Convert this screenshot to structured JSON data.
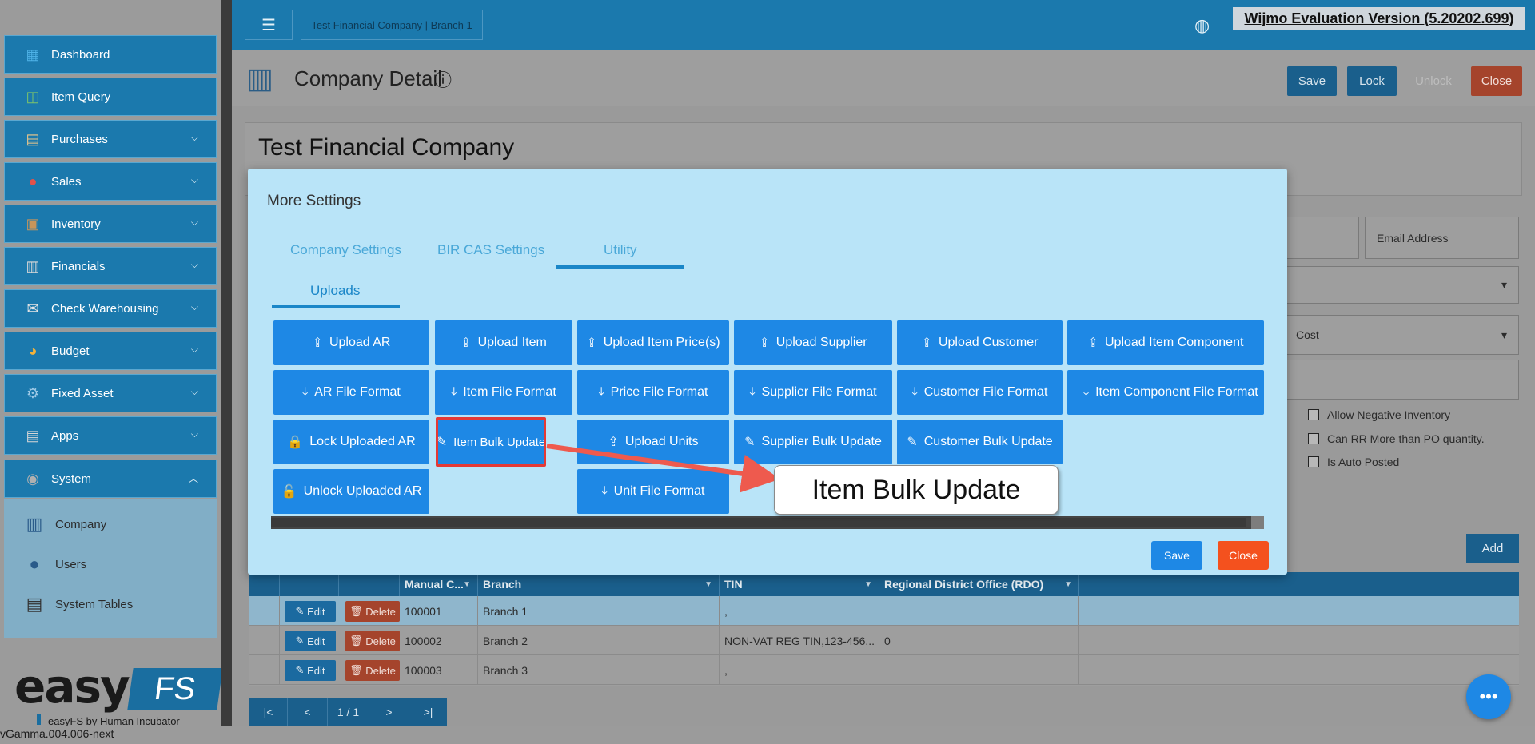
{
  "sidebar": {
    "items": [
      {
        "label": "Dashboard",
        "icon": "dashboard-icon",
        "glyph": "▦"
      },
      {
        "label": "Item Query",
        "icon": "basket-icon",
        "glyph": "🧺"
      },
      {
        "label": "Purchases",
        "icon": "clipboard-icon",
        "glyph": "📋"
      },
      {
        "label": "Sales",
        "icon": "sale-tag-icon",
        "glyph": "🏷"
      },
      {
        "label": "Inventory",
        "icon": "boxes-icon",
        "glyph": "📦"
      },
      {
        "label": "Financials",
        "icon": "ledger-icon",
        "glyph": "📒"
      },
      {
        "label": "Check Warehousing",
        "icon": "check-icon",
        "glyph": "✉"
      },
      {
        "label": "Budget",
        "icon": "pie-chart-icon",
        "glyph": "◕"
      },
      {
        "label": "Fixed Asset",
        "icon": "asset-icon",
        "glyph": "⚙"
      },
      {
        "label": "Apps",
        "icon": "apps-icon",
        "glyph": "▤"
      },
      {
        "label": "System",
        "icon": "system-icon",
        "glyph": "◉"
      }
    ],
    "system_sub": [
      {
        "label": "Company",
        "icon": "building-icon",
        "glyph": "🏢"
      },
      {
        "label": "Users",
        "icon": "user-icon",
        "glyph": "👤"
      },
      {
        "label": "System Tables",
        "icon": "table-icon",
        "glyph": "▤"
      }
    ],
    "logo_easy": "easy",
    "logo_fs": "FS",
    "logo_by": "easyFS by Human Incubator"
  },
  "version": "vGamma.004.006-next",
  "header": {
    "breadcrumb": "Test Financial Company | Branch 1",
    "watermark": "Wijmo Evaluation Version (5.20202.699)"
  },
  "page": {
    "title": "Company Detail",
    "save": "Save",
    "lock": "Lock",
    "unlock": "Unlock",
    "close": "Close",
    "company_name": "Test Financial Company",
    "email_placeholder": "Email Address",
    "cost_hint": "Cost",
    "checks": [
      "Allow Negative Inventory",
      "Can RR More than PO quantity.",
      "Is Auto Posted"
    ],
    "add": "Add"
  },
  "grid": {
    "columns": [
      "Manual C...",
      "Branch",
      "TIN",
      "Regional District Office (RDO)"
    ],
    "rows": [
      {
        "code": "100001",
        "branch": "Branch 1",
        "tin": ",",
        "rdo": ""
      },
      {
        "code": "100002",
        "branch": "Branch 2",
        "tin": "NON-VAT REG TIN,123-456...",
        "rdo": "0"
      },
      {
        "code": "100003",
        "branch": "Branch 3",
        "tin": ",",
        "rdo": ""
      }
    ],
    "edit": "Edit",
    "delete": "Delete",
    "pager": {
      "first": "|<",
      "prev": "<",
      "page": "1 / 1",
      "next": ">",
      "last": ">|"
    }
  },
  "modal": {
    "title": "More Settings",
    "tabs": [
      "Company Settings",
      "BIR CAS Settings",
      "Utility"
    ],
    "subtab": "Uploads",
    "buttons": [
      "Upload AR",
      "Upload Item",
      "Upload Item Price(s)",
      "Upload Supplier",
      "Upload Customer",
      "Upload Item Component",
      "AR File Format",
      "Item File Format",
      "Price File Format",
      "Supplier File Format",
      "Customer File Format",
      "Item Component File Format",
      "Lock Uploaded AR",
      "Item Bulk Update",
      "Upload Units",
      "Supplier Bulk Update",
      "Customer Bulk Update",
      "Unlock Uploaded AR",
      "Unit File Format"
    ],
    "save": "Save",
    "close": "Close"
  },
  "callout": "Item Bulk Update",
  "colors": {
    "primary": "#1e88e5",
    "danger": "#f4511e",
    "sidebar": "#1b79ad",
    "modal_bg": "#b9e4f8",
    "highlight": "#e53935"
  }
}
